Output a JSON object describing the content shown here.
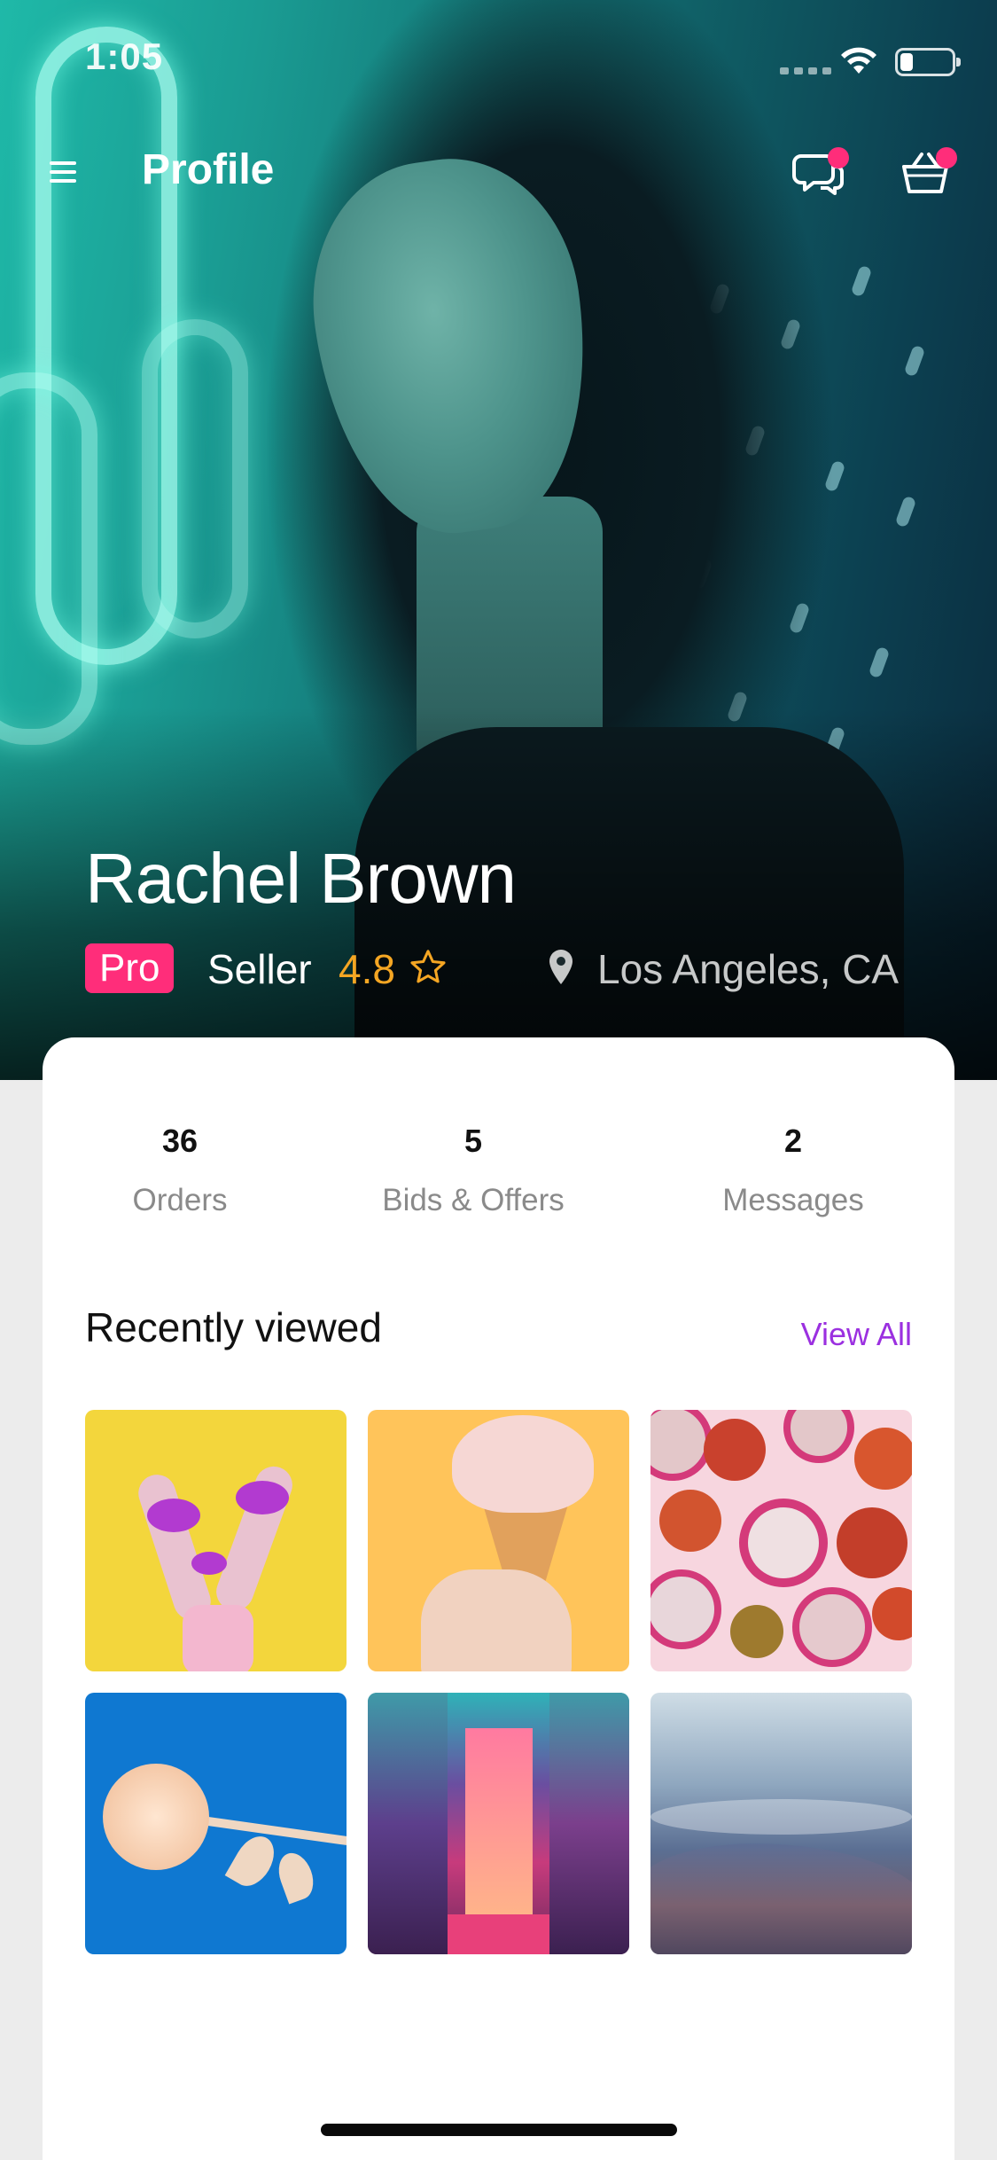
{
  "status_bar": {
    "time": "1:05",
    "battery_level": 0.22
  },
  "header": {
    "title": "Profile",
    "chat_badge_color": "#ff2d7a",
    "cart_badge_color": "#ff2d7a"
  },
  "profile": {
    "name": "Rachel Brown",
    "badge": "Pro",
    "badge_color": "#ff2d7a",
    "role": "Seller",
    "rating": "4.8",
    "rating_color": "#f5a623",
    "location": "Los Angeles, CA"
  },
  "stats": [
    {
      "value": "36",
      "label": "Orders"
    },
    {
      "value": "5",
      "label": "Bids & Offers"
    },
    {
      "value": "2",
      "label": "Messages"
    }
  ],
  "recently_viewed": {
    "title": "Recently viewed",
    "view_all": "View All",
    "view_all_color": "#9b30e0",
    "items": [
      {
        "subject": "hands-with-purple-paint"
      },
      {
        "subject": "ice-cream-cone"
      },
      {
        "subject": "sliced-fruits"
      },
      {
        "subject": "paper-rose"
      },
      {
        "subject": "neon-corridor"
      },
      {
        "subject": "mountain-landscape"
      }
    ]
  }
}
